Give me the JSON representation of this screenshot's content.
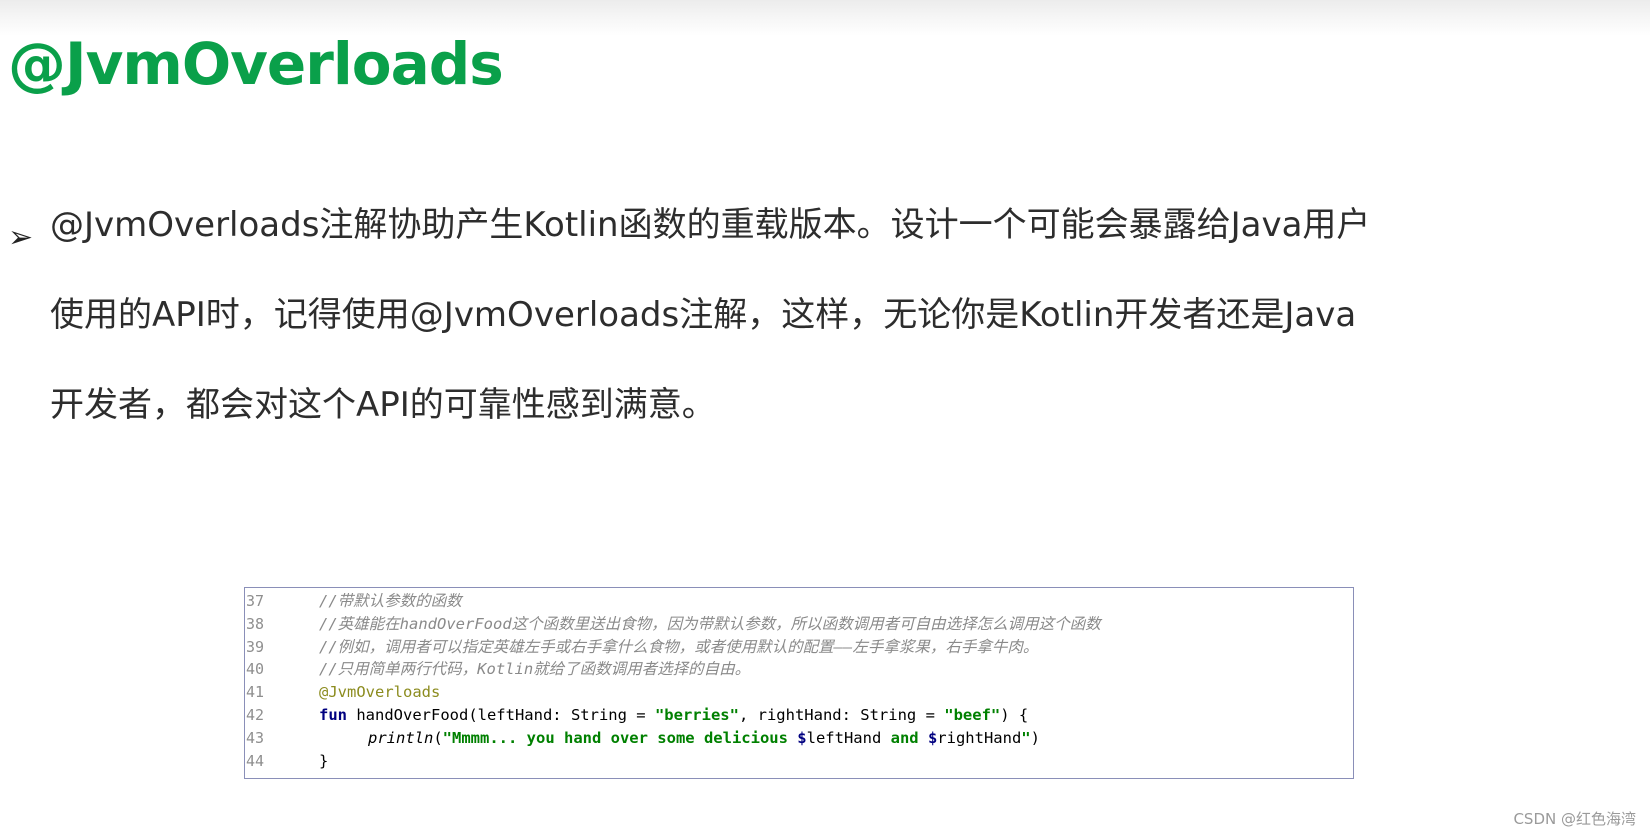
{
  "slide": {
    "title": "@JvmOverloads",
    "bullet_marker": "➢",
    "paragraph_lines": [
      "@JvmOverloads注解协助产生Kotlin函数的重载版本。设计一个可能会暴露给Java用户",
      "使用的API时，记得使用@JvmOverloads注解，这样，无论你是Kotlin开发者还是Java",
      "开发者，都会对这个API的可靠性感到满意。"
    ]
  },
  "code": {
    "lines": [
      {
        "num": "37",
        "parts": [
          {
            "text": "//带默认参数的函数",
            "style": "comment"
          }
        ]
      },
      {
        "num": "38",
        "parts": [
          {
            "text": "//英雄能在handOverFood这个函数里送出食物，因为带默认参数，所以函数调用者可自由选择怎么调用这个函数",
            "style": "comment"
          }
        ]
      },
      {
        "num": "39",
        "parts": [
          {
            "text": "//例如，调用者可以指定英雄左手或右手拿什么食物，或者使用默认的配置——左手拿浆果，右手拿牛肉。",
            "style": "comment"
          }
        ]
      },
      {
        "num": "40",
        "parts": [
          {
            "text": "//只用简单两行代码，Kotlin就给了函数调用者选择的自由。",
            "style": "comment"
          }
        ]
      },
      {
        "num": "41",
        "parts": [
          {
            "text": "@JvmOverloads",
            "style": "annot"
          }
        ]
      },
      {
        "num": "42",
        "parts": [
          {
            "text": "fun",
            "style": "kw"
          },
          {
            "text": " handOverFood(leftHand: String = ",
            "style": "plain"
          },
          {
            "text": "\"berries\"",
            "style": "str"
          },
          {
            "text": ", rightHand: String = ",
            "style": "plain"
          },
          {
            "text": "\"beef\"",
            "style": "str"
          },
          {
            "text": ") {",
            "style": "plain"
          }
        ]
      },
      {
        "num": "43",
        "indent": true,
        "parts": [
          {
            "text": "println",
            "style": "fn"
          },
          {
            "text": "(",
            "style": "plain"
          },
          {
            "text": "\"Mmmm... you hand over some delicious ",
            "style": "str"
          },
          {
            "text": "$",
            "style": "tmpl-sym"
          },
          {
            "text": "leftHand",
            "style": "tmpl"
          },
          {
            "text": " and ",
            "style": "str"
          },
          {
            "text": "$",
            "style": "tmpl-sym"
          },
          {
            "text": "rightHand",
            "style": "tmpl"
          },
          {
            "text": "\"",
            "style": "str"
          },
          {
            "text": ")",
            "style": "plain"
          }
        ]
      },
      {
        "num": "44",
        "parts": [
          {
            "text": "}",
            "style": "plain"
          }
        ]
      }
    ]
  },
  "watermark": "CSDN @红色海湾"
}
